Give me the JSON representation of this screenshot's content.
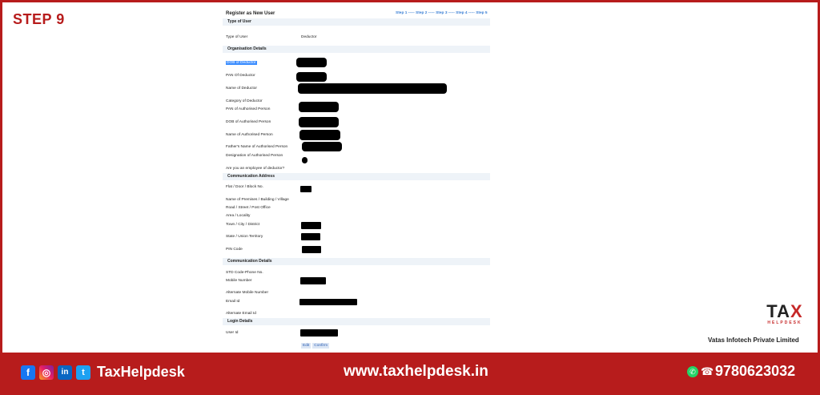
{
  "step_label": "STEP 9",
  "form": {
    "title": "Register as New User",
    "steps": "Step 1 ----- Step 2 ----- Step 3 ----- Step 4 ----- Step 5",
    "sections": {
      "type_of_user": "Type of User",
      "organisation": "Organisation Details",
      "comm_address": "Communication Address",
      "comm_details": "Communication Details",
      "login": "Login Details"
    },
    "fields": {
      "type_of_user_label": "Type of User",
      "type_of_user_value": "Deductor",
      "dob": "DOB of Deductor",
      "pan": "PAN Of Deductor",
      "name": "Name of Deductor",
      "category": "Category of Deductor",
      "pan_auth": "PAN of Authorised Person",
      "dob_auth": "DOB of Authorised Person",
      "name_auth": "Name of Authorised Person",
      "father_auth": "Father's Name of Authorised Person",
      "desig_auth": "Designation of Authorised Person",
      "employee": "Are you an employee of deductor?",
      "flat": "Flat / Door / Block No.",
      "premises": "Name of Premises / Building / Village",
      "road": "Road / Street / Post Office",
      "area": "Area / Locality",
      "town": "Town / City / District",
      "state": "State / Union Territory",
      "pin": "PIN Code",
      "std": "STD Code-Phone No.",
      "mobile": "Mobile Number",
      "alt_mobile": "Alternate Mobile Number",
      "email": "Email Id",
      "alt_email": "Alternate Email Id",
      "user_id": "User Id"
    },
    "buttons": {
      "edit": "Edit",
      "confirm": "Confirm"
    }
  },
  "branding": {
    "logo_text_left": "TA",
    "logo_text_x": "X",
    "logo_sub": "HELPDESK",
    "company": "Vatas Infotech Private Limited"
  },
  "footer": {
    "brand": "TaxHelpdesk",
    "website": "www.taxhelpdesk.in",
    "phone": "9780623032",
    "social_icons": [
      "facebook-icon",
      "instagram-icon",
      "linkedin-icon",
      "twitter-icon"
    ]
  },
  "colors": {
    "accent_red": "#b71c1c",
    "link_blue": "#3a7fd5",
    "section_bg": "#eef3f8"
  }
}
